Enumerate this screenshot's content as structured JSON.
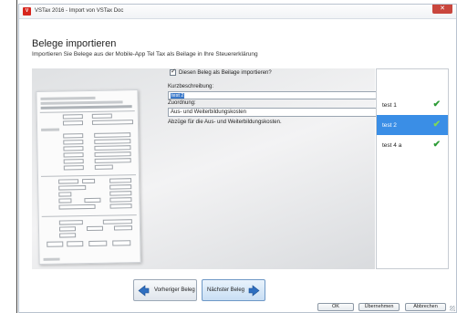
{
  "window": {
    "title": "VSTax 2016 - Import von VSTax Doc",
    "app_icon_letter": "V",
    "close_glyph": "✕"
  },
  "header": {
    "title": "Belege importieren",
    "subtitle": "Importieren Sie Belege aus der Mobile-App Tel Tax als Beilage in Ihre Steuererklärung"
  },
  "form": {
    "import_checkbox_label": "Diesen Beleg als Beilage importieren?",
    "import_checked": true,
    "short_desc_label": "Kurzbeschreibung:",
    "short_desc_value": "test 2",
    "assignment_label": "Zuordnung:",
    "assignment_value": "Aus- und Weiterbildungskosten",
    "assignment_description": "Abzüge für die Aus- und Weiterbildungskosten."
  },
  "documents": {
    "items": [
      {
        "label": "test 1",
        "selected": false,
        "status_icon": "check-icon"
      },
      {
        "label": "test 2",
        "selected": true,
        "status_icon": "check-icon"
      },
      {
        "label": "test 4 a",
        "selected": false,
        "status_icon": "check-icon"
      }
    ]
  },
  "navigation": {
    "prev_label": "Vorheriger Beleg",
    "next_label": "Nächster Beleg"
  },
  "footer": {
    "ok_label": "OK",
    "apply_label": "Übernehmen",
    "cancel_label": "Abbrechen"
  },
  "colors": {
    "selection": "#3a8ee6",
    "check_green": "#2d9b36",
    "close_red": "#c9463d"
  }
}
